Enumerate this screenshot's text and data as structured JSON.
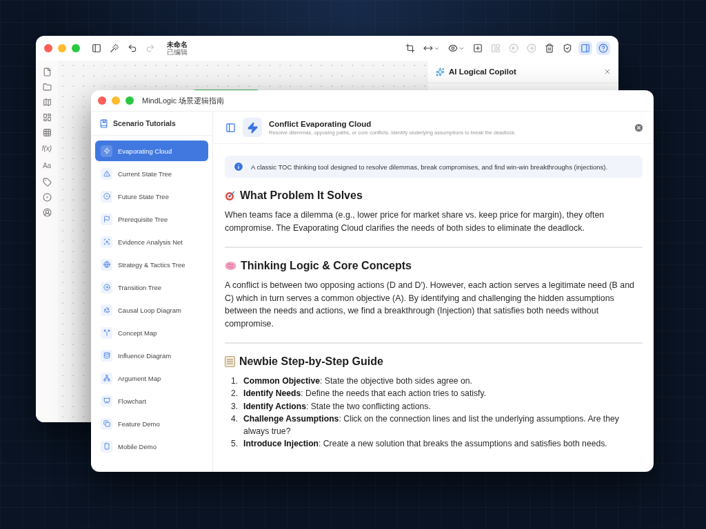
{
  "back_window": {
    "title": "未命名",
    "subtitle": "已编辑",
    "toolbar_left": [
      {
        "disabled": false
      },
      {
        "disabled": false
      },
      {
        "disabled": false
      },
      {
        "disabled": true
      }
    ],
    "toolbar_right": [
      {
        "disabled": false,
        "on": false
      },
      {
        "disabled": false,
        "on": false
      },
      {
        "disabled": false,
        "on": false
      },
      {
        "disabled": false,
        "on": false
      },
      {
        "disabled": true,
        "on": false
      },
      {
        "disabled": true,
        "on": false
      },
      {
        "disabled": true,
        "on": false
      },
      {
        "disabled": false,
        "on": false
      },
      {
        "disabled": false,
        "on": false
      },
      {
        "disabled": false,
        "on": true
      },
      {
        "disabled": false,
        "on": true
      }
    ],
    "rail_texts": [
      "f(x)",
      "Aa"
    ],
    "copilot": {
      "title": "AI Logical Copilot"
    }
  },
  "front_window": {
    "title": "MindLogic 场景逻辑指南",
    "sidebar": {
      "title": "Scenario Tutorials",
      "items": [
        {
          "label": "Evaporating Cloud",
          "selected": true
        },
        {
          "label": "Current State Tree",
          "selected": false
        },
        {
          "label": "Future State Tree",
          "selected": false
        },
        {
          "label": "Prerequisite Tree",
          "selected": false
        },
        {
          "label": "Evidence Analysis Net",
          "selected": false
        },
        {
          "label": "Strategy & Tactics Tree",
          "selected": false
        },
        {
          "label": "Transition Tree",
          "selected": false
        },
        {
          "label": "Causal Loop Diagram",
          "selected": false
        },
        {
          "label": "Concept Map",
          "selected": false
        },
        {
          "label": "Influence Diagram",
          "selected": false
        },
        {
          "label": "Argument Map",
          "selected": false
        },
        {
          "label": "Flowchart",
          "selected": false
        },
        {
          "label": "Feature Demo",
          "selected": false
        },
        {
          "label": "Mobile Demo",
          "selected": false
        }
      ]
    },
    "header": {
      "title": "Conflict Evaporating Cloud",
      "subtitle": "Resolve dilemmas, opposing paths, or core conflicts. Identify underlying assumptions to break the deadlock."
    },
    "info": "A classic TOC thinking tool designed to resolve dilemmas, break compromises, and find win-win breakthroughs (injections).",
    "sections": [
      {
        "kind": "paragraph",
        "heading": "What Problem It Solves",
        "text": "When teams face a dilemma (e.g., lower price for market share vs. keep price for margin), they often compromise. The Evaporating Cloud clarifies the needs of both sides to eliminate the deadlock."
      },
      {
        "kind": "paragraph",
        "heading": "Thinking Logic & Core Concepts",
        "text": "A conflict is between two opposing actions (D and D'). However, each action serves a legitimate need (B and C) which in turn serves a common objective (A). By identifying and challenging the hidden assumptions between the needs and actions, we find a breakthrough (Injection) that satisfies both needs without compromise."
      },
      {
        "kind": "steps",
        "heading": "Newbie Step-by-Step Guide",
        "steps": [
          {
            "number": "1.",
            "text": "**Common Objective**: State the objective both sides agree on."
          },
          {
            "number": "2.",
            "text": "**Identify Needs**: Define the needs that each action tries to satisfy."
          },
          {
            "number": "3.",
            "text": "**Identify Actions**: State the two conflicting actions."
          },
          {
            "number": "4.",
            "text": "**Challenge Assumptions**: Click on the connection lines and list the underlying assumptions. Are they always true?"
          },
          {
            "number": "5.",
            "text": "**Introduce Injection**: Create a new solution that breaks the assumptions and satisfies both needs."
          }
        ]
      }
    ]
  }
}
